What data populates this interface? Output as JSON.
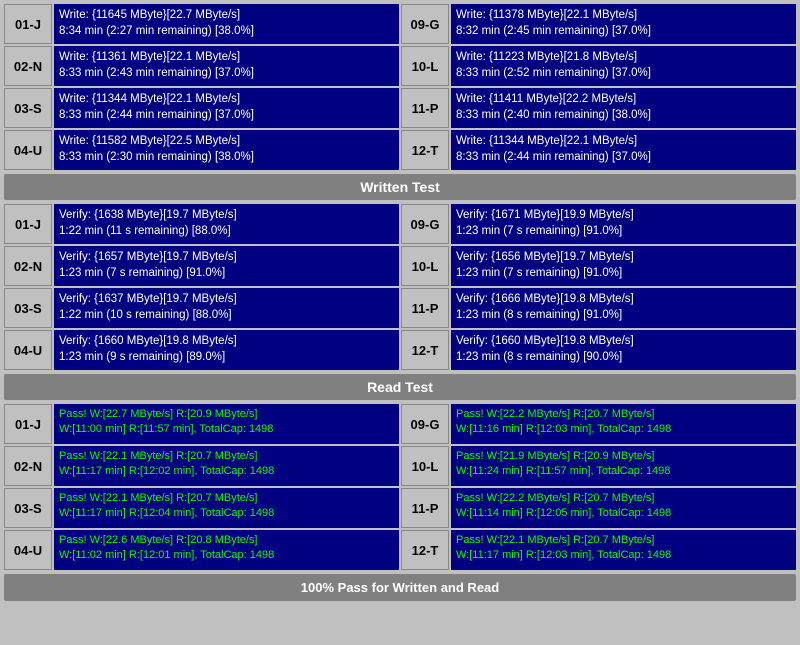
{
  "sections": {
    "write": {
      "header": "Written Test",
      "rows": [
        {
          "id_left": "01-J",
          "left_line1": "Write: {11645 MByte}[22.7 MByte/s]",
          "left_line2": "8:34 min (2:27 min remaining)  [38.0%]",
          "id_right": "09-G",
          "right_line1": "Write: {11378 MByte}[22.1 MByte/s]",
          "right_line2": "8:32 min (2:45 min remaining)  [37.0%]"
        },
        {
          "id_left": "02-N",
          "left_line1": "Write: {11361 MByte}[22.1 MByte/s]",
          "left_line2": "8:33 min (2:43 min remaining)  [37.0%]",
          "id_right": "10-L",
          "right_line1": "Write: {11223 MByte}[21.8 MByte/s]",
          "right_line2": "8:33 min (2:52 min remaining)  [37.0%]"
        },
        {
          "id_left": "03-S",
          "left_line1": "Write: {11344 MByte}[22.1 MByte/s]",
          "left_line2": "8:33 min (2:44 min remaining)  [37.0%]",
          "id_right": "11-P",
          "right_line1": "Write: {11411 MByte}[22.2 MByte/s]",
          "right_line2": "8:33 min (2:40 min remaining)  [38.0%]"
        },
        {
          "id_left": "04-U",
          "left_line1": "Write: {11582 MByte}[22.5 MByte/s]",
          "left_line2": "8:33 min (2:30 min remaining)  [38.0%]",
          "id_right": "12-T",
          "right_line1": "Write: {11344 MByte}[22.1 MByte/s]",
          "right_line2": "8:33 min (2:44 min remaining)  [37.0%]"
        }
      ]
    },
    "verify": {
      "rows": [
        {
          "id_left": "01-J",
          "left_line1": "Verify: {1638 MByte}[19.7 MByte/s]",
          "left_line2": "1:22 min (11 s remaining)  [88.0%]",
          "id_right": "09-G",
          "right_line1": "Verify: {1671 MByte}[19.9 MByte/s]",
          "right_line2": "1:23 min (7 s remaining)  [91.0%]"
        },
        {
          "id_left": "02-N",
          "left_line1": "Verify: {1657 MByte}[19.7 MByte/s]",
          "left_line2": "1:23 min (7 s remaining)  [91.0%]",
          "id_right": "10-L",
          "right_line1": "Verify: {1656 MByte}[19.7 MByte/s]",
          "right_line2": "1:23 min (7 s remaining)  [91.0%]"
        },
        {
          "id_left": "03-S",
          "left_line1": "Verify: {1637 MByte}[19.7 MByte/s]",
          "left_line2": "1:22 min (10 s remaining)  [88.0%]",
          "id_right": "11-P",
          "right_line1": "Verify: {1666 MByte}[19.8 MByte/s]",
          "right_line2": "1:23 min (8 s remaining)  [91.0%]"
        },
        {
          "id_left": "04-U",
          "left_line1": "Verify: {1660 MByte}[19.8 MByte/s]",
          "left_line2": "1:23 min (9 s remaining)  [89.0%]",
          "id_right": "12-T",
          "right_line1": "Verify: {1660 MByte}[19.8 MByte/s]",
          "right_line2": "1:23 min (8 s remaining)  [90.0%]"
        }
      ]
    },
    "read": {
      "header": "Read Test",
      "rows": [
        {
          "id_left": "01-J",
          "left_line1": "Pass! W:[22.7 MByte/s] R:[20.9 MByte/s]",
          "left_line2": "W:[11:00 min] R:[11:57 min], TotalCap: 1498",
          "id_right": "09-G",
          "right_line1": "Pass! W:[22.2 MByte/s] R:[20.7 MByte/s]",
          "right_line2": "W:[11:16 min] R:[12:03 min], TotalCap: 1498"
        },
        {
          "id_left": "02-N",
          "left_line1": "Pass! W:[22.1 MByte/s] R:[20.7 MByte/s]",
          "left_line2": "W:[11:17 min] R:[12:02 min], TotalCap: 1498",
          "id_right": "10-L",
          "right_line1": "Pass! W:[21.9 MByte/s] R:[20.9 MByte/s]",
          "right_line2": "W:[11:24 min] R:[11:57 min], TotalCap: 1498"
        },
        {
          "id_left": "03-S",
          "left_line1": "Pass! W:[22.1 MByte/s] R:[20.7 MByte/s]",
          "left_line2": "W:[11:17 min] R:[12:04 min], TotalCap: 1498",
          "id_right": "11-P",
          "right_line1": "Pass! W:[22.2 MByte/s] R:[20.7 MByte/s]",
          "right_line2": "W:[11:14 min] R:[12:05 min], TotalCap: 1498"
        },
        {
          "id_left": "04-U",
          "left_line1": "Pass! W:[22.6 MByte/s] R:[20.8 MByte/s]",
          "left_line2": "W:[11:02 min] R:[12:01 min], TotalCap: 1498",
          "id_right": "12-T",
          "right_line1": "Pass! W:[22.1 MByte/s] R:[20.7 MByte/s]",
          "right_line2": "W:[11:17 min] R:[12:03 min], TotalCap: 1498"
        }
      ]
    }
  },
  "labels": {
    "written_test": "Written Test",
    "read_test": "Read Test",
    "footer": "100% Pass for Written and Read"
  }
}
